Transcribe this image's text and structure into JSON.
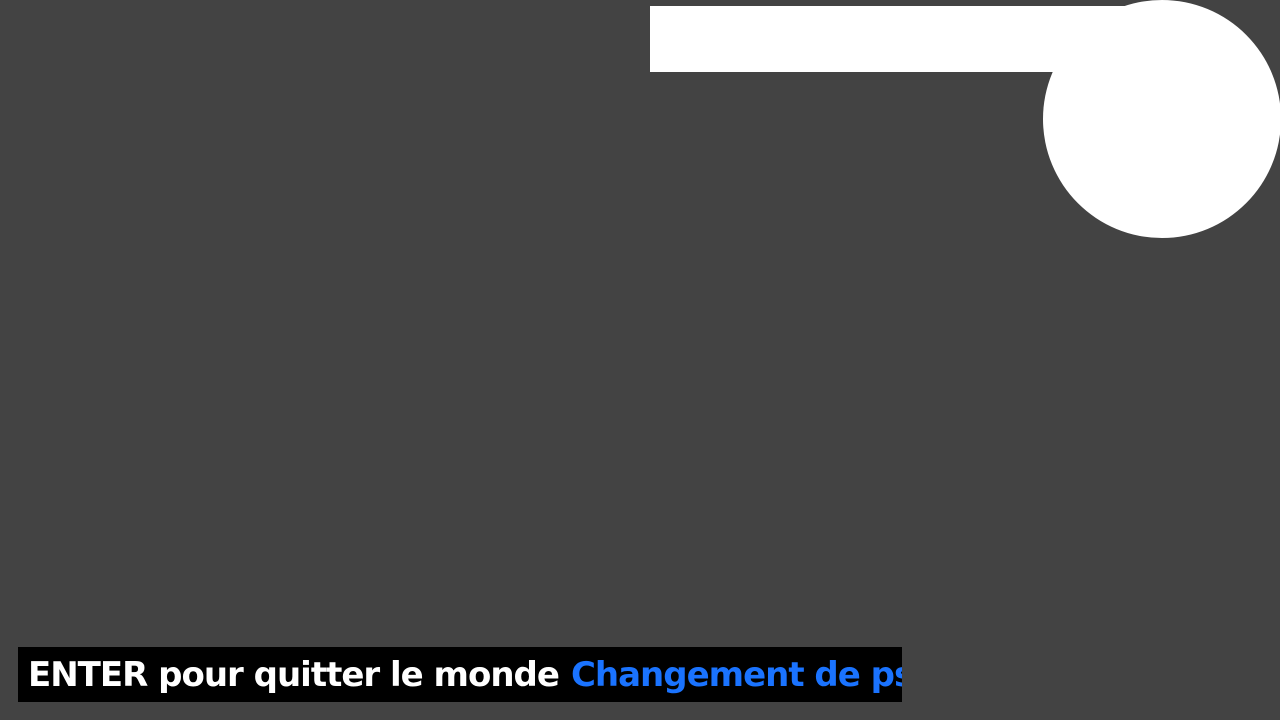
{
  "hint_bar": {
    "text": "ENTER pour quitter le monde",
    "link": "Changement de pseudo"
  },
  "colors": {
    "background": "#434343",
    "panel": "#ffffff",
    "hint_background": "#000000",
    "hint_text": "#ffffff",
    "link": "#1a73ff"
  }
}
